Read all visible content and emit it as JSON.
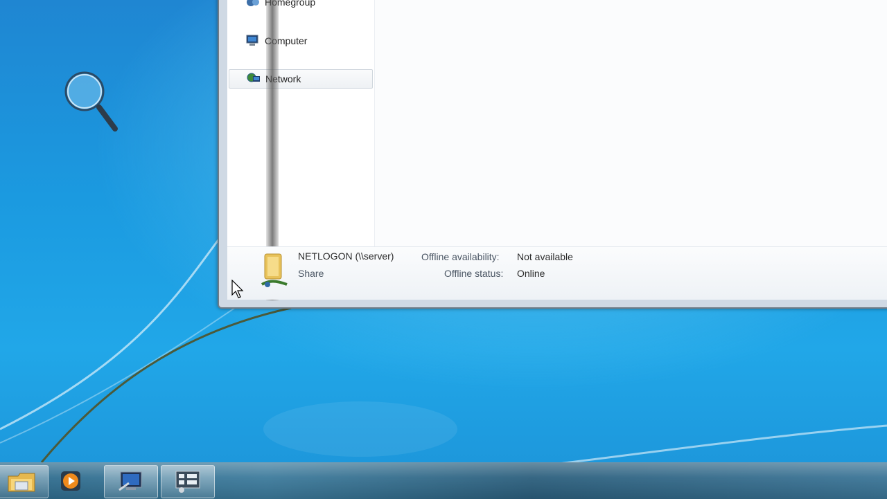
{
  "navigation": {
    "items": [
      {
        "label": "Homegroup",
        "icon": "homegroup-icon"
      },
      {
        "label": "Computer",
        "icon": "computer-icon"
      },
      {
        "label": "Network",
        "icon": "network-icon",
        "selected": true
      }
    ]
  },
  "details_pane": {
    "name": "NETLOGON (\\\\server)",
    "type": "Share",
    "offline_availability_label": "Offline availability:",
    "offline_availability_value": "Not available",
    "offline_status_label": "Offline status:",
    "offline_status_value": "Online",
    "icon": "network-share-folder-icon"
  },
  "taskbar": {
    "buttons": [
      {
        "icon": "windows-explorer-icon",
        "active": true
      },
      {
        "icon": "media-player-icon",
        "active": false
      },
      {
        "icon": "remote-desktop-icon",
        "active": true
      },
      {
        "icon": "control-panel-icon",
        "active": true
      }
    ]
  },
  "colors": {
    "desktop": "#1b9ae0",
    "taskbar": "#2e6b8d",
    "selection_border": "#cfd6dd"
  }
}
